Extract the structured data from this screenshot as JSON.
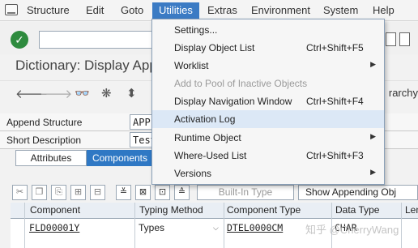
{
  "menubar": {
    "items": [
      "Structure",
      "Edit",
      "Goto",
      "Utilities",
      "Extras",
      "Environment",
      "System",
      "Help"
    ],
    "active_index": 3
  },
  "title": "Dictionary: Display Appe",
  "app_toolbar": {
    "hierarchy_label": "rarchy"
  },
  "fields": {
    "append_structure": {
      "label": "Append Structure",
      "value": "APP"
    },
    "short_description": {
      "label": "Short Description",
      "value": "Test"
    }
  },
  "tabs": [
    "Attributes",
    "Components"
  ],
  "active_tab": "Components",
  "table_toolbar": {
    "builtin_type": "Built-In Type",
    "show_appending_obj": "Show Appending Obj"
  },
  "table": {
    "headers": [
      "Component",
      "Typing Method",
      "Component Type",
      "Data Type",
      "Len"
    ],
    "rows": [
      {
        "component": "FLD00001Y",
        "typing_method": "Types",
        "component_type": "DTEL0000CM",
        "data_type": "CHAR"
      }
    ]
  },
  "utilities_menu": {
    "items": [
      {
        "label": "Settings...",
        "shortcut": "",
        "submenu": false,
        "disabled": false
      },
      {
        "label": "Display Object List",
        "shortcut": "Ctrl+Shift+F5",
        "submenu": false,
        "disabled": false
      },
      {
        "label": "Worklist",
        "shortcut": "",
        "submenu": true,
        "disabled": false
      },
      {
        "label": "Add to Pool of Inactive Objects",
        "shortcut": "",
        "submenu": false,
        "disabled": true
      },
      {
        "label": "Display Navigation Window",
        "shortcut": "Ctrl+Shift+F4",
        "submenu": false,
        "disabled": false
      },
      {
        "label": "Activation Log",
        "shortcut": "",
        "submenu": false,
        "disabled": false
      },
      {
        "label": "Runtime Object",
        "shortcut": "",
        "submenu": true,
        "disabled": false
      },
      {
        "label": "Where-Used List",
        "shortcut": "Ctrl+Shift+F3",
        "submenu": false,
        "disabled": false
      },
      {
        "label": "Versions",
        "shortcut": "",
        "submenu": true,
        "disabled": false
      }
    ],
    "hovered": "Activation Log"
  },
  "watermark": "知乎 @CherryWang",
  "colors": {
    "menu_active": "#3b7bc4",
    "tab_active": "#2f78c4",
    "ok_green": "#2e8b3e"
  }
}
